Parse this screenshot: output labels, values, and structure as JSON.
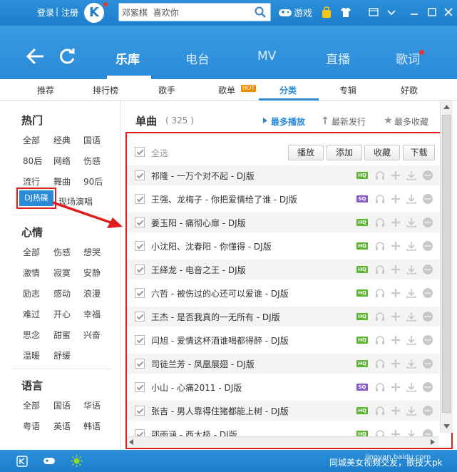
{
  "topbar": {
    "login": "登录",
    "separator": "|",
    "register": "注册",
    "logo_letter": "K",
    "search_value": "邓紫棋  喜欢你",
    "game_label": "游戏"
  },
  "nav": {
    "tabs": [
      "乐库",
      "电台",
      "MV",
      "直播",
      "歌词"
    ],
    "active_tab": "乐库"
  },
  "subnav": {
    "tabs": [
      "推荐",
      "排行榜",
      "歌手",
      "歌单",
      "分类",
      "专辑",
      "好歌"
    ],
    "hot_badge": "HOT",
    "active_tab": "分类"
  },
  "sidebar": {
    "sections": [
      {
        "title": "热门",
        "items": [
          "全部",
          "经典",
          "国语",
          "80后",
          "网络",
          "伤感",
          "流行",
          "舞曲",
          "90后",
          "DJ热碟",
          "现场演唱"
        ]
      },
      {
        "title": "心情",
        "items": [
          "全部",
          "伤感",
          "想哭",
          "激情",
          "寂寞",
          "安静",
          "励志",
          "感动",
          "浪漫",
          "难过",
          "开心",
          "幸福",
          "思念",
          "甜蜜",
          "兴奋",
          "温暖",
          "舒缓"
        ]
      },
      {
        "title": "语言",
        "items": [
          "全部",
          "国语",
          "华语",
          "粤语",
          "英语",
          "韩语"
        ]
      }
    ],
    "selected_item": "DJ热碟"
  },
  "main": {
    "title": "单曲",
    "count": "( 325 )",
    "sort_options": [
      "最多播放",
      "最新发行",
      "最多收藏"
    ],
    "active_sort": "最多播放",
    "select_all_label": "全选",
    "actions": [
      "播放",
      "添加",
      "收藏",
      "下载"
    ],
    "songs": [
      {
        "title": "祁隆 - 一万个对不起 - DJ版",
        "quality": "HQ"
      },
      {
        "title": "王强、龙梅子 - 你把爱情给了谁 - DJ版",
        "quality": "SQ"
      },
      {
        "title": "姜玉阳 - 痛彻心扉 - DJ版",
        "quality": "HQ"
      },
      {
        "title": "小沈阳、沈春阳 - 你懂得 - DJ版",
        "quality": "HQ"
      },
      {
        "title": "王绎龙 - 电音之王 - DJ版",
        "quality": "HQ"
      },
      {
        "title": "六哲 - 被伤过的心还可以爱谁 - DJ版",
        "quality": "HQ"
      },
      {
        "title": "王杰 - 是否我真的一无所有 - DJ版",
        "quality": "HQ"
      },
      {
        "title": "闫旭 - 爱情这杯酒谁喝都得醉 - DJ版",
        "quality": "HQ"
      },
      {
        "title": "司徒兰芳 - 凤凰展翅 - DJ版",
        "quality": "HQ"
      },
      {
        "title": "小山 - 心痛2011 - DJ版",
        "quality": "SQ"
      },
      {
        "title": "张吉 - 男人靠得住猪都能上树 - DJ版",
        "quality": "HQ"
      },
      {
        "title": "邵雨涵 - 西太极 - DJ版",
        "quality": "HQ"
      }
    ]
  },
  "bottombar": {
    "marquee": "同城美女视频交友，歌技大pk",
    "watermark": "jingyan.baidu.com"
  },
  "colors": {
    "brand_blue": "#2a8ad8",
    "highlight_red": "#e01c1c",
    "hq_green": "#5cb531",
    "sq_purple": "#8a5cc9"
  }
}
